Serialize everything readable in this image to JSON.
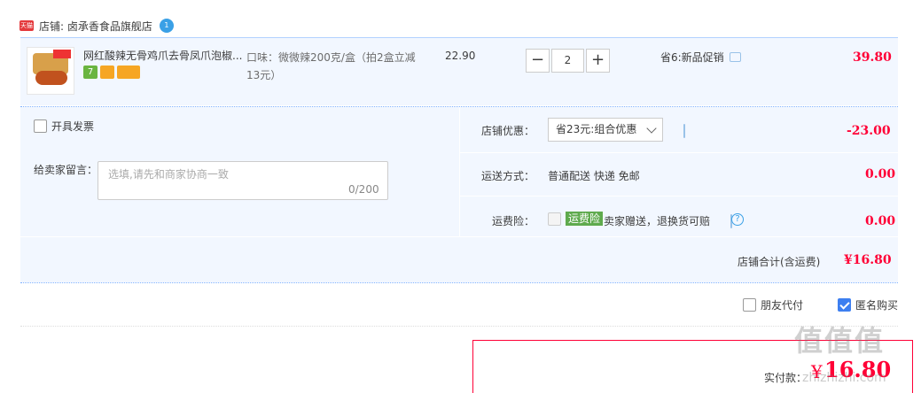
{
  "store": {
    "logo_text": "天猫",
    "label": "店铺: 卤承香食品旗舰店",
    "ww_icon": "wangwang-icon",
    "ww_text": "1"
  },
  "item": {
    "title": "网红酸辣无骨鸡爪去骨凤爪泡椒...",
    "badges": [
      "7",
      "",
      ""
    ],
    "sku": "口味：微微辣200克/盒（拍2盒立减13元）",
    "price": "22.90",
    "qty_minus": "−",
    "qty": "2",
    "qty_plus": "+",
    "promo": "省6:新品促销",
    "subtotal": "39.80"
  },
  "invoice": {
    "label": "开具发票"
  },
  "message": {
    "label": "给卖家留言：",
    "placeholder": "选填,请先和商家协商一致",
    "count": "0/200"
  },
  "discount": {
    "label": "店铺优惠：",
    "selected": "省23元:组合优惠",
    "value": "-23.00"
  },
  "shipping": {
    "label": "运送方式：",
    "method": "普通配送 快递 免邮",
    "value": "0.00"
  },
  "insurance": {
    "label": "运费险：",
    "badge": "运费险",
    "text": "卖家赠送，退换货可赔",
    "help": "?",
    "value": "0.00"
  },
  "total": {
    "label": "店铺合计(含运费)",
    "value": "¥16.80"
  },
  "options": {
    "friend_pay": "朋友代付",
    "anonymous": "匿名购买"
  },
  "pay": {
    "label": "实付款：",
    "currency": "¥",
    "value": "16.80"
  },
  "watermark": {
    "text": "值值值",
    "url": "zhizhizhi.com"
  },
  "colors": {
    "accent_red": "#ff0036",
    "light_blue_bg": "#f2f7ff",
    "checkbox_blue": "#3d7ff0"
  }
}
